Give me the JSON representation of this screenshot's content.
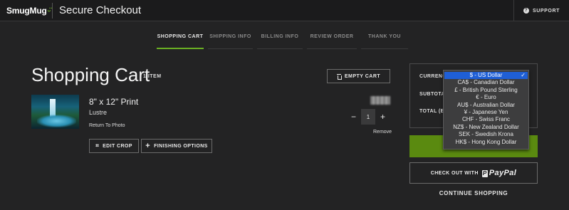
{
  "header": {
    "logo": "SmugMug",
    "title": "Secure Checkout",
    "support_label": "SUPPORT",
    "support_icon": "question-circle-icon"
  },
  "steps": [
    {
      "label": "SHOPPING CART",
      "active": true
    },
    {
      "label": "SHIPPING INFO",
      "active": false
    },
    {
      "label": "BILLING INFO",
      "active": false
    },
    {
      "label": "REVIEW ORDER",
      "active": false
    },
    {
      "label": "THANK YOU",
      "active": false
    }
  ],
  "cart": {
    "title": "Shopping Cart",
    "count": "1 ITEM",
    "empty_label": "EMPTY CART",
    "item": {
      "name": "8\" x 12\" Print",
      "finish": "Lustre",
      "return_link": "Return To Photo",
      "quantity": "1",
      "decrement": "−",
      "increment": "+",
      "remove": "Remove",
      "edit_crop": "EDIT CROP",
      "finishing_options": "FINISHING OPTIONS"
    }
  },
  "summary": {
    "currency_label": "CURRENCY",
    "subtotal_label": "SUBTOTAL",
    "total_label": "TOTAL (ES",
    "paypal_prefix": "CHECK OUT WITH",
    "paypal_brand": "PayPal",
    "continue": "CONTINUE SHOPPING"
  },
  "currency_options": [
    {
      "label": "$ - US Dollar",
      "selected": true
    },
    {
      "label": "CA$ - Canadian Dollar",
      "selected": false
    },
    {
      "label": "£ - British Pound Sterling",
      "selected": false
    },
    {
      "label": "€ - Euro",
      "selected": false
    },
    {
      "label": "AU$ - Australian Dollar",
      "selected": false
    },
    {
      "label": "¥ - Japanese Yen",
      "selected": false
    },
    {
      "label": "CHF - Swiss Franc",
      "selected": false
    },
    {
      "label": "NZ$ - New Zealand Dollar",
      "selected": false
    },
    {
      "label": "SEK - Swedish Krona",
      "selected": false
    },
    {
      "label": "HK$ - Hong Kong Dollar",
      "selected": false
    }
  ],
  "colors": {
    "accent": "#6ab023",
    "checkout_button": "#5a8a10",
    "selected_option": "#1f5fd6",
    "background": "#232324"
  }
}
